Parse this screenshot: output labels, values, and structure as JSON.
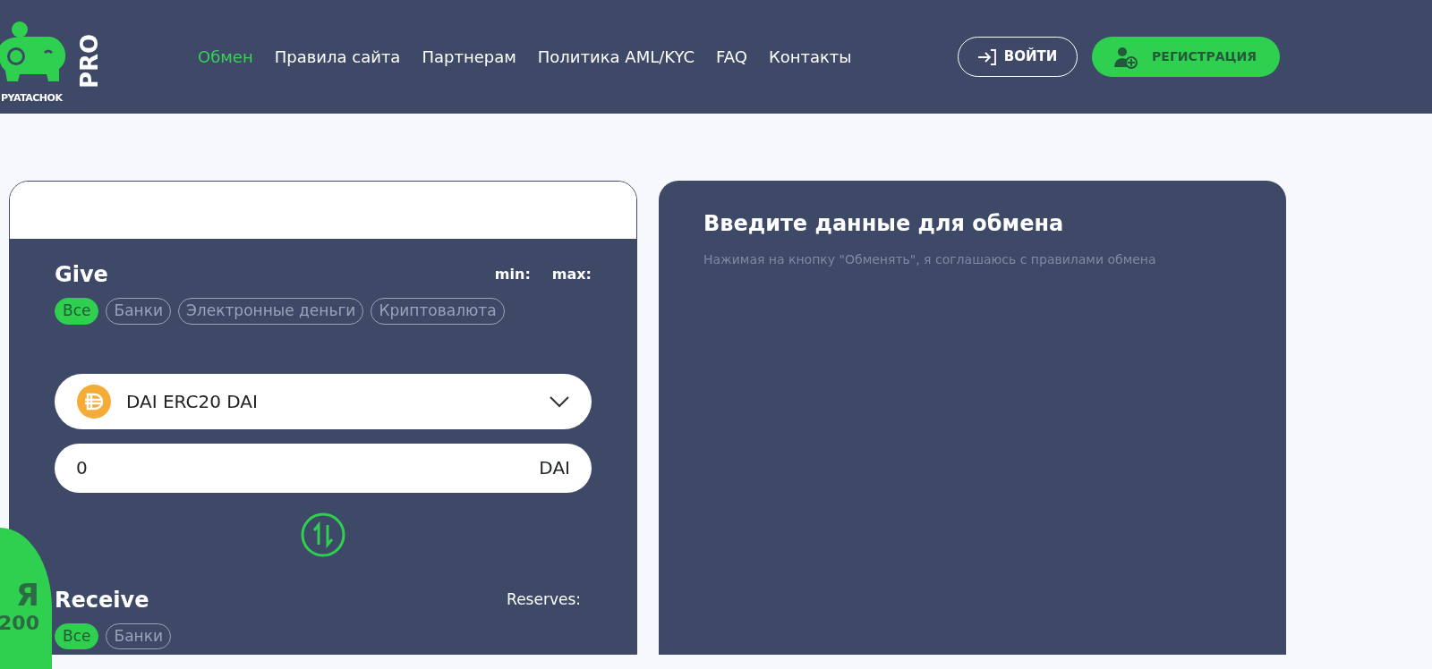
{
  "logo": {
    "name": "PYATACHOK",
    "suffix": "PRO"
  },
  "nav": [
    {
      "label": "Обмен",
      "selected": true
    },
    {
      "label": "Правила сайта",
      "selected": false
    },
    {
      "label": "Партнерам",
      "selected": false
    },
    {
      "label": "Политика AML/KYC",
      "selected": false
    },
    {
      "label": "FAQ",
      "selected": false
    },
    {
      "label": "Контакты",
      "selected": false
    }
  ],
  "login_button": "ВОЙТИ",
  "register_button": "РЕГИСТРАЦИЯ",
  "give": {
    "title": "Give",
    "min": "min:",
    "max": "max:",
    "filters": [
      {
        "label": "Все",
        "selected": true
      },
      {
        "label": "Банки",
        "selected": false
      },
      {
        "label": "Электронные деньги",
        "selected": false
      },
      {
        "label": "Криптовалюта",
        "selected": false
      }
    ],
    "currency": "DAI ERC20 DAI",
    "amount": "0",
    "unit": "DAI"
  },
  "receive": {
    "title": "Receive",
    "reserves": "Reserves:",
    "filters": [
      {
        "label": "Все",
        "selected": true
      },
      {
        "label": "Банки",
        "selected": false
      }
    ]
  },
  "details": {
    "title": "Введите данные для обмена",
    "note": "Нажимая на кнопку \"Обменять\", я соглашаюсь с правилами обмена"
  },
  "promo": {
    "letter": "Я",
    "number": "200"
  }
}
